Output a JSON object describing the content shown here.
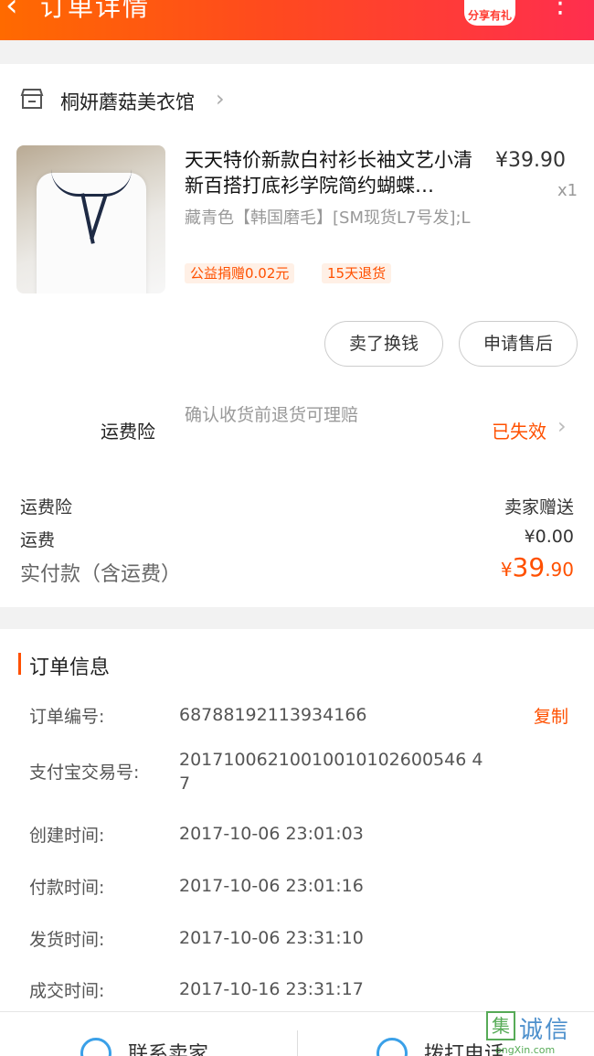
{
  "header": {
    "back_icon": "‹",
    "title": "订单详情",
    "share_label": "分享有礼",
    "more_icon": "⋮"
  },
  "shop": {
    "name": "桐妍蘑菇美衣馆",
    "chevron": "›"
  },
  "product": {
    "title": "天天特价新款白衬衫长袖文艺小清新百搭打底衫学院简约蝴蝶…",
    "price": "¥39.90",
    "qty": "x1",
    "spec": "藏青色【韩国磨毛】[SM现货L7号发];L",
    "tags": [
      "公益捐赠0.02元",
      "15天退货"
    ]
  },
  "actions": {
    "sell_label": "卖了换钱",
    "after_sale_label": "申请售后"
  },
  "insurance": {
    "label": "运费险",
    "desc": "确认收货前退货可理赔",
    "status": "已失效",
    "chevron": "›"
  },
  "fees": {
    "insurance_label": "运费险",
    "insurance_value": "卖家赠送",
    "shipping_label": "运费",
    "shipping_value": "¥0.00",
    "total_label": "实付款（含运费）",
    "total_symbol": "¥",
    "total_int": "39",
    "total_dec": ".90"
  },
  "order_info": {
    "title": "订单信息",
    "copy_label": "复制",
    "rows": [
      {
        "key": "订单编号:",
        "value": "68788192113934166"
      },
      {
        "key": "支付宝交易号:",
        "value": "20171006210010010102600546 47"
      },
      {
        "key": "创建时间:",
        "value": "2017-10-06 23:01:03"
      },
      {
        "key": "付款时间:",
        "value": "2017-10-06 23:01:16"
      },
      {
        "key": "发货时间:",
        "value": "2017-10-06 23:31:10"
      },
      {
        "key": "成交时间:",
        "value": "2017-10-16 23:31:17"
      }
    ]
  },
  "bottom_bar": {
    "contact_seller": "联系卖家",
    "call_phone": "拨打电话"
  },
  "watermark": {
    "box_char": "集",
    "text": "诚信",
    "sub": "ongXin.com"
  },
  "colors": {
    "accent": "#ff5000",
    "header_start": "#ff6a00",
    "header_end": "#ff2e4e",
    "icon_blue": "#3aa0e8"
  }
}
